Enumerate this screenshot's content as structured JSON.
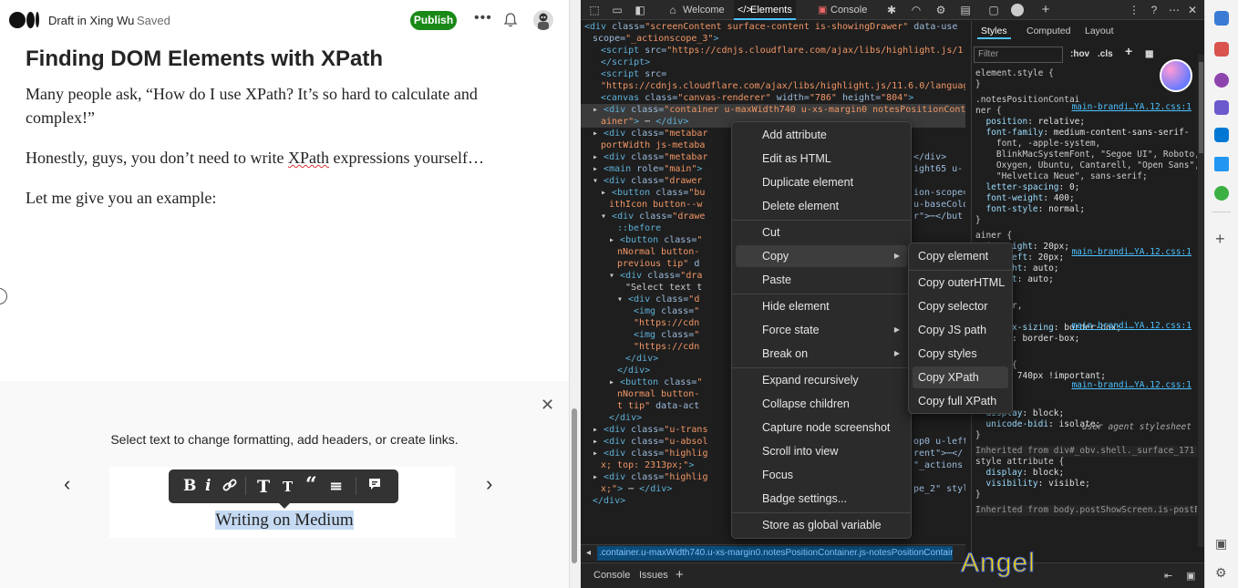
{
  "medium": {
    "header": {
      "draft_label": "Draft in Xing Wu",
      "saved_label": "Saved",
      "publish_label": "Publish",
      "more_icon": "more-horizontal-icon",
      "bell_icon": "bell-icon"
    },
    "article": {
      "title": "Finding DOM Elements with XPath",
      "paragraph_1": "Many people ask, “How do I use XPath? It’s so hard to calculate and complex!”",
      "paragraph_2_before": "Honestly, guys, you don’t need to write ",
      "paragraph_2_xpath": "XPath",
      "paragraph_2_after": " expressions yourself…",
      "paragraph_3": "Let me give you an example:"
    },
    "tooltip_panel": {
      "hint": "Select text to change formatting, add headers, or create links.",
      "close": "✕",
      "prev": "‹",
      "next": "›",
      "toolbar": [
        "B",
        "i",
        "🔗",
        "T",
        "T",
        "“",
        "≡",
        "💬"
      ],
      "demo_text": "Writing on Medium"
    }
  },
  "devtools": {
    "tabs": {
      "welcome": "Welcome",
      "elements": "Elements",
      "console": "Console"
    },
    "dom_lines": [
      {
        "indent": 0,
        "html": "<span class='tag'>&lt;div</span> <span class='attr'>class=</span><span class='val'>\"screenContent surface-content is-showingDrawer\"</span> <span class='attr'>data-use</span>"
      },
      {
        "indent": 1,
        "html": "<span class='attr'>scope=</span><span class='val'>\"_actionscope_3\"</span><span class='tag'>&gt;</span>"
      },
      {
        "indent": 2,
        "html": "<span class='tag'>&lt;script</span> <span class='attr'>src=</span><span class='val'>\"https://cdnjs.cloudflare.com/ajax/libs/highlight.js/1</span>"
      },
      {
        "indent": 2,
        "html": "<span class='tag'>&lt;/script&gt;</span>"
      },
      {
        "indent": 2,
        "html": "<span class='tag'>&lt;script</span> <span class='attr'>src=</span>"
      },
      {
        "indent": 2,
        "html": "<span class='val'>\"https://cdnjs.cloudflare.com/ajax/libs/highlight.js/11.6.0/languag</span>"
      },
      {
        "indent": 2,
        "html": "<span class='tag'>&lt;canvas</span> <span class='attr'>class=</span><span class='val'>\"canvas-renderer\"</span> <span class='attr'>width=</span><span class='val'>\"786\"</span> <span class='attr'>height=</span><span class='val'>\"804\"</span><span class='tag'>&gt;</span>"
      },
      {
        "indent": 1,
        "html": "▸ <span class='tag'>&lt;div</span> <span class='attr'>class=</span><span class='val'>\"container u-maxWidth740 u-xs-margin0 notesPositionCont</span>"
      },
      {
        "indent": 2,
        "html": "<span class='val'>ainer\"</span><span class='tag'>&gt;</span> ⋯ <span class='tag'>&lt;/div&gt;</span>"
      },
      {
        "indent": 1,
        "html": "▸ <span class='tag'>&lt;div</span> <span class='attr'>class=</span><span class='val'>\"metabar</span>"
      },
      {
        "indent": 2,
        "html": "<span class='val'>portWidth js-metaba</span>"
      },
      {
        "indent": 1,
        "html": "▸ <span class='tag'>&lt;div</span> <span class='attr'>class=</span><span class='val'>\"metabar</span>"
      },
      {
        "indent": 1,
        "html": "▸ <span class='tag'>&lt;main</span> <span class='attr'>role=</span><span class='val'>\"main\"</span><span class='tag'>&gt;</span>"
      },
      {
        "indent": 1,
        "html": "▾ <span class='tag'>&lt;div</span> <span class='attr'>class=</span><span class='val'>\"drawer</span>"
      },
      {
        "indent": 2,
        "html": "▸ <span class='tag'>&lt;button</span> <span class='attr'>class=</span><span class='val'>\"bu</span>"
      },
      {
        "indent": 3,
        "html": "<span class='val'>ithIcon button--w</span>"
      },
      {
        "indent": 2,
        "html": "▾ <span class='tag'>&lt;div</span> <span class='attr'>class=</span><span class='val'>\"drawe</span>"
      },
      {
        "indent": 4,
        "html": "<span class='tag'>::before</span>"
      },
      {
        "indent": 3,
        "html": "▸ <span class='tag'>&lt;button</span> <span class='attr'>class=</span><span class='val'>\"</span>"
      },
      {
        "indent": 4,
        "html": "<span class='val'>nNormal button-</span>"
      },
      {
        "indent": 4,
        "html": "<span class='val'>previous tip\"</span> <span class='attr'>d</span>"
      },
      {
        "indent": 3,
        "html": "▾ <span class='tag'>&lt;div</span> <span class='attr'>class=</span><span class='val'>\"dra</span>"
      },
      {
        "indent": 5,
        "html": "<span class='txt'>\"Select text t</span>"
      },
      {
        "indent": 4,
        "html": "▾ <span class='tag'>&lt;div</span> <span class='attr'>class=</span><span class='val'>\"d</span>"
      },
      {
        "indent": 6,
        "html": "<span class='tag'>&lt;img</span> <span class='attr'>class=</span><span class='val'>\"</span>"
      },
      {
        "indent": 6,
        "html": "<span class='val'>\"https://cdn</span>"
      },
      {
        "indent": 6,
        "html": "<span class='tag'>&lt;img</span> <span class='attr'>class=</span><span class='val'>\"</span>"
      },
      {
        "indent": 6,
        "html": "<span class='val'>\"https://cdn</span>"
      },
      {
        "indent": 5,
        "html": "<span class='tag'>&lt;/div&gt;</span>"
      },
      {
        "indent": 4,
        "html": "<span class='tag'>&lt;/div&gt;</span>"
      },
      {
        "indent": 3,
        "html": "▸ <span class='tag'>&lt;button</span> <span class='attr'>class=</span><span class='val'>\"</span>"
      },
      {
        "indent": 4,
        "html": "<span class='val'>nNormal button-</span>"
      },
      {
        "indent": 4,
        "html": "<span class='val'>t tip\"</span> <span class='attr'>data-act</span>"
      },
      {
        "indent": 3,
        "html": "<span class='tag'>&lt;/div&gt;</span>"
      },
      {
        "indent": 1,
        "html": "▸ <span class='tag'>&lt;div</span> <span class='attr'>class=</span><span class='val'>\"u-trans</span>"
      },
      {
        "indent": 1,
        "html": "▸ <span class='tag'>&lt;div</span> <span class='attr'>class=</span><span class='val'>\"u-absol</span>"
      },
      {
        "indent": 1,
        "html": "▸ <span class='tag'>&lt;div</span> <span class='attr'>class=</span><span class='val'>\"highlig</span>"
      },
      {
        "indent": 2,
        "html": "<span class='val'>x; top: 2313px;\"</span><span class='tag'>&gt;</span>"
      },
      {
        "indent": 1,
        "html": "▸ <span class='tag'>&lt;div</span> <span class='attr'>class=</span><span class='val'>\"highlig</span>"
      },
      {
        "indent": 2,
        "html": "<span class='val'>x;\"</span><span class='tag'>&gt;</span> ⋯ <span class='tag'>&lt;/div&gt;</span>"
      },
      {
        "indent": 1,
        "html": "<span class='tag'>&lt;/div&gt;</span>"
      }
    ],
    "dom_tail": [
      "ion-scope=",
      "u-baseColo",
      "r\">⋯</but",
      "</div>",
      "ight65 u-",
      "op0 u-left",
      "rent\">⋯</",
      "\"_actions",
      "pe_2\" styl"
    ],
    "breadcrumb": ".container.u-maxWidth740.u-xs-margin0.notesPositionContainer.js-notesPositionContainer",
    "bottom_tabs": {
      "console": "Console",
      "issues": "Issues"
    },
    "styles": {
      "tabs": {
        "styles": "Styles",
        "computed": "Computed",
        "layout": "Layout"
      },
      "filter_placeholder": "Filter",
      "hov": ":hov",
      "cls": ".cls",
      "lines": [
        "element.style {",
        "}",
        ".notesPositionContai",
        "ner {",
        "  position: relative;",
        "  font-family: medium-content-sans-serif-",
        "    font, -apple-system,",
        "    BlinkMacSystemFont, \"Segoe UI\", Roboto,",
        "    Oxygen, Ubuntu, Cantarell, \"Open Sans\",",
        "    \"Helvetica Neue\", sans-serif;",
        "  letter-spacing: 0;",
        "  font-weight: 400;",
        "  font-style: normal;",
        "}",
        "ainer {",
        "  ing-right: 20px;",
        "  ing-left: 20px;",
        "  n-right: auto;",
        "  n-left: auto;",
        "}",
        "ontainer,",
        "",
        "  it-box-sizing: border-box;",
        "  izing: border-box;",
        "}",
        "dth740 {",
        "  idth: 740px !important;",
        "}",
        "div {",
        "  display: block;",
        "  unicode-bidi: isolate;",
        "}",
        "Inherited from div#_obv.shell._surface_171",
        "style attribute {",
        "  display: block;",
        "  visibility: visible;",
        "}",
        "Inherited from body.postShowScreen.is-postE"
      ],
      "sources": [
        "main-brandi…YA.12.css:1",
        "main-brandi…YA.12.css:1",
        "main-brandi…YA.12.css:1",
        "main-brandi…YA.12.css:1"
      ],
      "ua_label": "user agent stylesheet"
    }
  },
  "context_menu": {
    "items": [
      "Add attribute",
      "Edit as HTML",
      "Duplicate element",
      "Delete element",
      "Cut",
      "Copy",
      "Paste",
      "Hide element",
      "Force state",
      "Break on",
      "Expand recursively",
      "Collapse children",
      "Capture node screenshot",
      "Scroll into view",
      "Focus",
      "Badge settings...",
      "Store as global variable"
    ]
  },
  "copy_submenu": {
    "items": [
      "Copy element",
      "Copy outerHTML",
      "Copy selector",
      "Copy JS path",
      "Copy styles",
      "Copy XPath",
      "Copy full XPath"
    ]
  },
  "watermark": "Angel",
  "colors": {
    "publish": "#1a8917",
    "selection": "#c5daf2",
    "devtools_bg": "#1e1e1e",
    "accent": "#4cc2ff"
  }
}
